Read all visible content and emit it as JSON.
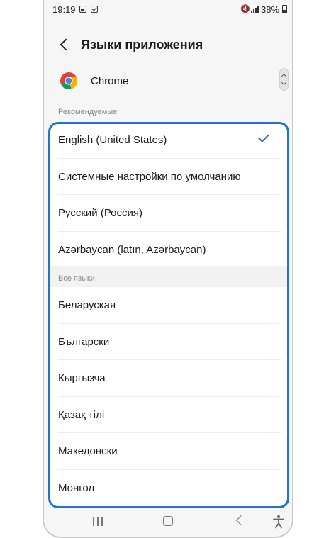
{
  "status_bar": {
    "time": "19:19",
    "battery": "38%",
    "icons": [
      "gallery-icon",
      "check-box-icon",
      "mute-icon",
      "signal-icon",
      "battery-icon"
    ]
  },
  "app_bar": {
    "title": "Языки приложения",
    "back_icon": "chevron-left-icon"
  },
  "app": {
    "name": "Chrome",
    "icon": "chrome-logo-icon"
  },
  "sections": {
    "recommended_header": "Рекомендуемые",
    "all_header": "Все языки"
  },
  "recommended_languages": [
    {
      "label": "English (United States)",
      "selected": true
    },
    {
      "label": "Системные настройки по умолчанию",
      "selected": false
    },
    {
      "label": "Русский (Россия)",
      "selected": false
    },
    {
      "label": "Azərbaycan (latın, Azərbaycan)",
      "selected": false
    }
  ],
  "all_languages": [
    {
      "label": "Беларуская"
    },
    {
      "label": "Български"
    },
    {
      "label": "Кыргызча"
    },
    {
      "label": "Қазақ тілі"
    },
    {
      "label": "Македонски"
    },
    {
      "label": "Монгол"
    }
  ],
  "nav_bar": {
    "icons": [
      "recents-icon",
      "home-icon",
      "back-icon",
      "accessibility-icon"
    ]
  },
  "colors": {
    "highlight": "#1f73d6",
    "check": "#2f6fb2",
    "background": "#f6f6f6",
    "card": "#ffffff"
  }
}
